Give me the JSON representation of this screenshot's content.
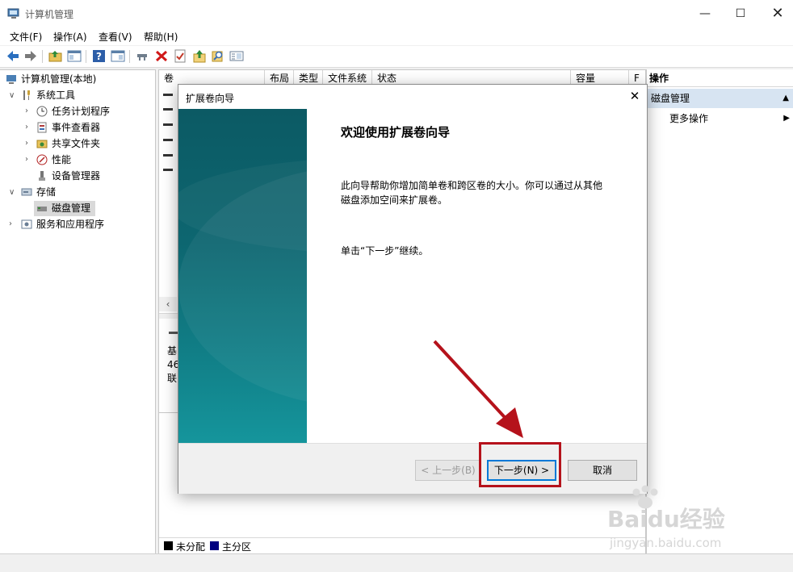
{
  "window": {
    "title": "计算机管理",
    "controls": [
      "minimize-icon",
      "maximize-icon",
      "close-icon"
    ]
  },
  "menubar": {
    "items": [
      "文件(F)",
      "操作(A)",
      "查看(V)",
      "帮助(H)"
    ]
  },
  "toolbar": {
    "icons": [
      "back-arrow-icon",
      "forward-arrow-icon",
      "folder-up-icon",
      "console-tree-icon",
      "help-icon",
      "show-panel-icon",
      "connect-icon",
      "delete-icon",
      "properties-icon",
      "import-icon",
      "search-icon",
      "export-list-icon"
    ]
  },
  "tree": {
    "root": "计算机管理(本地)",
    "groups": [
      {
        "label": "系统工具",
        "children": [
          "任务计划程序",
          "事件查看器",
          "共享文件夹",
          "性能",
          "设备管理器"
        ]
      },
      {
        "label": "存储",
        "children": [
          "磁盘管理"
        ]
      },
      {
        "label": "服务和应用程序",
        "children": []
      }
    ]
  },
  "volume_table": {
    "columns": [
      "卷",
      "布局",
      "类型",
      "文件系统",
      "状态",
      "容量",
      "F"
    ]
  },
  "disk_view": {
    "lines": [
      "基",
      "46",
      "联"
    ],
    "legend": [
      "未分配",
      "主分区"
    ],
    "legend_colors": [
      "#000000",
      "#000080"
    ]
  },
  "actions": {
    "header": "操作",
    "section": "磁盘管理",
    "more": "更多操作"
  },
  "dialog": {
    "title": "扩展卷向导",
    "heading": "欢迎使用扩展卷向导",
    "body_line1": "此向导帮助你增加简单卷和跨区卷的大小。你可以通过从其他",
    "body_line2": "磁盘添加空间来扩展卷。",
    "continue_text": "单击“下一步”继续。",
    "back_button": "< 上一步(B)",
    "next_button": "下一步(N) >",
    "cancel_button": "取消"
  },
  "annotation": {
    "color": "#b5121b"
  },
  "watermark": {
    "brand": "Baidu经验",
    "url": "jingyan.baidu.com"
  }
}
